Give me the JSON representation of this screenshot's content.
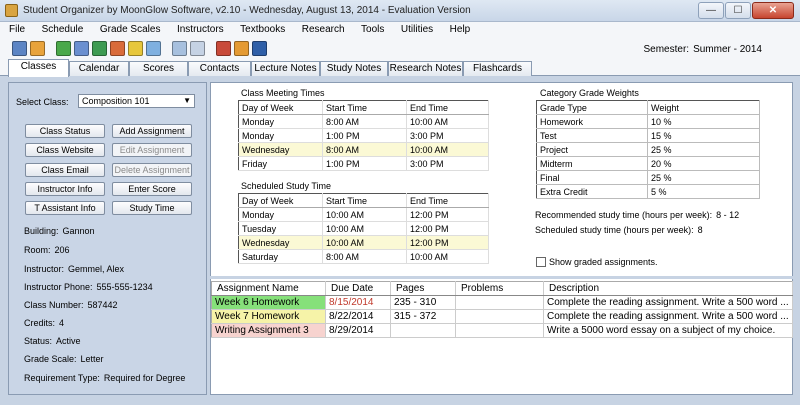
{
  "window": {
    "title": "Student Organizer by MoonGlow Software, v2.10  -  Wednesday, August 13, 2014  -  Evaluation Version",
    "minimize": "—",
    "maximize": "☐",
    "close": "✕"
  },
  "menu": [
    "File",
    "Schedule",
    "Grade Scales",
    "Instructors",
    "Textbooks",
    "Research",
    "Tools",
    "Utilities",
    "Help"
  ],
  "semester": {
    "label": "Semester:",
    "value": "Summer - 2014"
  },
  "tabs": [
    "Classes",
    "Calendar",
    "Scores",
    "Contacts",
    "Lecture Notes",
    "Study Notes",
    "Research Notes",
    "Flashcards"
  ],
  "left": {
    "select_label": "Select Class:",
    "select_value": "Composition 101",
    "buttons": [
      "Class Status",
      "Add Assignment",
      "Class Website",
      "Edit Assignment",
      "Class Email",
      "Delete Assignment",
      "Instructor Info",
      "Enter Score",
      "T Assistant Info",
      "Study Time"
    ],
    "info": [
      {
        "label": "Building:",
        "value": "Gannon"
      },
      {
        "label": "Room:",
        "value": "206"
      },
      {
        "label": "Instructor:",
        "value": "Gemmel, Alex"
      },
      {
        "label": "Instructor Phone:",
        "value": "555-555-1234"
      },
      {
        "label": "Class Number:",
        "value": "587442"
      },
      {
        "label": "Credits:",
        "value": "4"
      },
      {
        "label": "Status:",
        "value": "Active"
      },
      {
        "label": "Grade Scale:",
        "value": "Letter"
      },
      {
        "label": "Requirement Type:",
        "value": "Required for Degree"
      }
    ]
  },
  "meeting": {
    "title": "Class Meeting Times",
    "headers": [
      "Day of Week",
      "Start Time",
      "End Time"
    ],
    "rows": [
      [
        "Monday",
        "8:00 AM",
        "10:00 AM"
      ],
      [
        "Monday",
        "1:00 PM",
        "3:00 PM"
      ],
      [
        "Wednesday",
        "8:00 AM",
        "10:00 AM"
      ],
      [
        "Friday",
        "1:00 PM",
        "3:00 PM"
      ]
    ]
  },
  "study": {
    "title": "Scheduled Study Time",
    "headers": [
      "Day of Week",
      "Start Time",
      "End Time"
    ],
    "rows": [
      [
        "Monday",
        "10:00 AM",
        "12:00 PM"
      ],
      [
        "Tuesday",
        "10:00 AM",
        "12:00 PM"
      ],
      [
        "Wednesday",
        "10:00 AM",
        "12:00 PM"
      ],
      [
        "Saturday",
        "8:00 AM",
        "10:00 AM"
      ]
    ]
  },
  "weights": {
    "title": "Category Grade Weights",
    "headers": [
      "Grade Type",
      "Weight"
    ],
    "rows": [
      [
        "Homework",
        "10 %"
      ],
      [
        "Test",
        "15 %"
      ],
      [
        "Project",
        "25 %"
      ],
      [
        "Midterm",
        "20 %"
      ],
      [
        "Final",
        "25 %"
      ],
      [
        "Extra Credit",
        "5 %"
      ]
    ]
  },
  "stats": {
    "recommended_label": "Recommended study time (hours per week):",
    "recommended_value": "8 - 12",
    "scheduled_label": "Scheduled study time (hours per week):",
    "scheduled_value": "8",
    "show_graded": "Show graded assignments."
  },
  "assignments": {
    "headers": [
      "Assignment Name",
      "Due Date",
      "Pages",
      "Problems",
      "Description"
    ],
    "rows": [
      {
        "name": "Week 6 Homework",
        "due": "8/15/2014",
        "pages": "235 - 310",
        "problems": "",
        "desc": "Complete the reading assignment. Write a 500 word ...",
        "name_bg": "#86e07a",
        "due_color": "#c0392b"
      },
      {
        "name": "Week 7 Homework",
        "due": "8/22/2014",
        "pages": "315 - 372",
        "problems": "",
        "desc": "Complete the reading assignment. Write a 500 word ...",
        "name_bg": "#f6f3a8",
        "due_color": "#000000"
      },
      {
        "name": "Writing Assignment 3",
        "due": "8/29/2014",
        "pages": "",
        "problems": "",
        "desc": "Write a 5000 word essay on a subject of my choice.",
        "name_bg": "#f7d3cf",
        "due_color": "#000000"
      }
    ]
  },
  "toolbar_icons": [
    "new-class-icon",
    "edit-icon",
    "schedule-icon",
    "notes-icon",
    "books-icon",
    "calendar-icon",
    "grades-icon",
    "alarm-icon",
    "contacts-icon",
    "search-icon",
    "tools-icon",
    "print-icon",
    "exit-icon"
  ]
}
